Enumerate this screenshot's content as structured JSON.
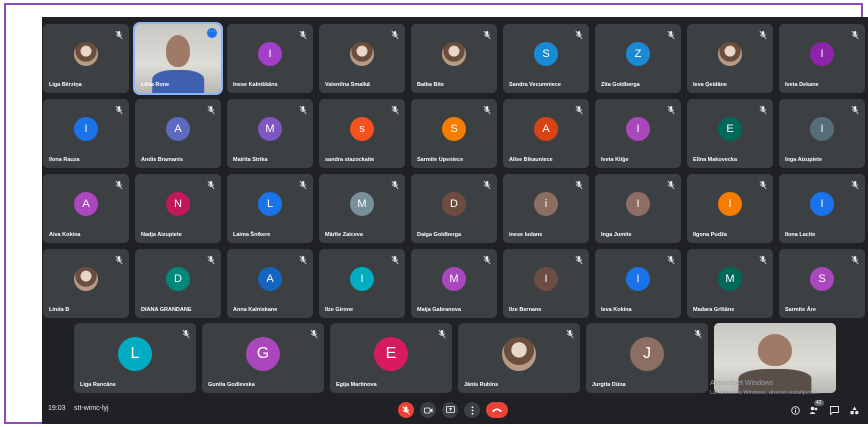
{
  "colors": {
    "muted": "#9aa0a6"
  },
  "tiles": [
    {
      "name": "Liga Bērziņa",
      "avatar": "photo"
    },
    {
      "name": "Lilita Rone",
      "avatar": "video"
    },
    {
      "name": "Inese Kalniškāns",
      "letter": "I",
      "color": "#a23fc9"
    },
    {
      "name": "Valentīna Smalkā",
      "avatar": "photo"
    },
    {
      "name": "Baiba Bite",
      "avatar": "photo"
    },
    {
      "name": "Sandra Vecumniece",
      "letter": "S",
      "color": "#1a8ad4"
    },
    {
      "name": "Zita Goldberga",
      "letter": "Z",
      "color": "#1a8ad4"
    },
    {
      "name": "Ieva Ģeidāne",
      "avatar": "photo"
    },
    {
      "name": "Iveta Dekane",
      "letter": "I",
      "color": "#8e24aa"
    },
    {
      "name": "Ilona Rauza",
      "letter": "I",
      "color": "#1a73e8"
    },
    {
      "name": "Andis Bramanis",
      "letter": "A",
      "color": "#5c6bc0"
    },
    {
      "name": "Mairita Strika",
      "letter": "M",
      "color": "#7e57c2"
    },
    {
      "name": "sandra stazockaite",
      "letter": "s",
      "color": "#f4511e"
    },
    {
      "name": "Sarmite Upeniece",
      "letter": "S",
      "color": "#f57c00"
    },
    {
      "name": "Alise Bikauniece",
      "letter": "A",
      "color": "#d84315"
    },
    {
      "name": "Iveta Kliģe",
      "letter": "I",
      "color": "#ab47bc"
    },
    {
      "name": "Elīna Makovecka",
      "letter": "E",
      "color": "#00695c"
    },
    {
      "name": "Inga Aizupiete",
      "letter": "I",
      "color": "#546e7a"
    },
    {
      "name": "Aiva Kokina",
      "letter": "A",
      "color": "#ab47bc"
    },
    {
      "name": "Nadja Aizupiete",
      "letter": "N",
      "color": "#c2185b"
    },
    {
      "name": "Laima Šnikere",
      "letter": "L",
      "color": "#1a73e8"
    },
    {
      "name": "Mārīte Zaiceva",
      "letter": "M",
      "color": "#78909c"
    },
    {
      "name": "Daiga Goldberga",
      "letter": "D",
      "color": "#6d4c41"
    },
    {
      "name": "inese ludane",
      "letter": "i",
      "color": "#8d6e63"
    },
    {
      "name": "Inga Jumite",
      "letter": "I",
      "color": "#8d6e63"
    },
    {
      "name": "Ilgona Pudža",
      "letter": "I",
      "color": "#f57c00"
    },
    {
      "name": "Ilona Lacite",
      "letter": "I",
      "color": "#1a73e8"
    },
    {
      "name": "Linda B",
      "avatar": "photo"
    },
    {
      "name": "DIANA GRANDANE",
      "letter": "D",
      "color": "#00897b"
    },
    {
      "name": "Anna Kalniskane",
      "letter": "A",
      "color": "#1565c0"
    },
    {
      "name": "Ilze Girone",
      "letter": "I",
      "color": "#00acc1"
    },
    {
      "name": "Maija Gabranova",
      "letter": "M",
      "color": "#ab47bc"
    },
    {
      "name": "Ilze Bernane",
      "letter": "I",
      "color": "#6d4c41"
    },
    {
      "name": "Ieva Kokina",
      "letter": "I",
      "color": "#1a73e8"
    },
    {
      "name": "Madara Grīšāne",
      "letter": "M",
      "color": "#00695c"
    },
    {
      "name": "Sarmite Āre",
      "letter": "S",
      "color": "#ab47bc"
    },
    {
      "name": "Liga Rancāne",
      "letter": "L",
      "color": "#00acc1"
    },
    {
      "name": "Gunita Godlevska",
      "letter": "G",
      "color": "#ab47bc"
    },
    {
      "name": "Egija Martinova",
      "letter": "E",
      "color": "#d81b60"
    },
    {
      "name": "Jānis Rubīns",
      "avatar": "photo"
    },
    {
      "name": "Jurgita Dūna",
      "letter": "J",
      "color": "#8d6e63"
    },
    {
      "name": "",
      "avatar": "video"
    }
  ],
  "bar": {
    "time": "19:03",
    "meeting_code": "stt-wimc-lyj",
    "icons": [
      "mic-off-icon",
      "present-icon",
      "captions-icon",
      "more-icon",
      "end-call-icon"
    ],
    "right_icons": [
      "info-icon",
      "people-icon",
      "chat-icon",
      "activities-icon"
    ],
    "participants_badge": "42"
  },
  "watermark": {
    "title": "Aktivizējiet Windows",
    "text": "Lai aktivizētu Windows, atveriet iestatījumus."
  }
}
